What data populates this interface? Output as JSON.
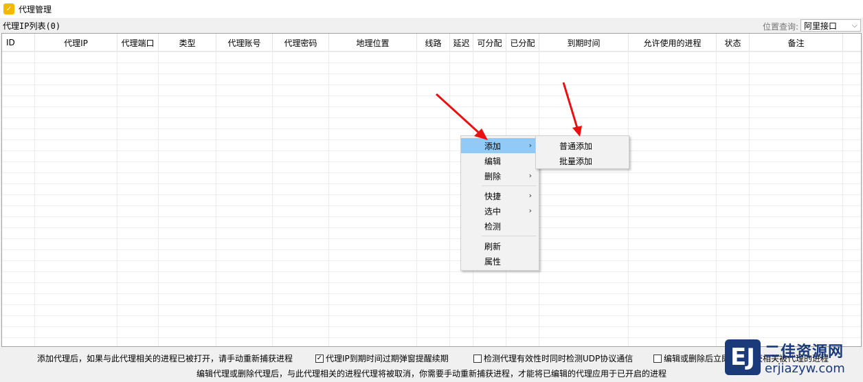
{
  "window": {
    "title": "代理管理",
    "icon": "app-logo-icon"
  },
  "listbar": {
    "list_label": "代理IP列表(0)",
    "location_label": "位置查询:",
    "location_value": "阿里接口"
  },
  "table": {
    "columns": [
      "ID",
      "代理IP",
      "代理端口",
      "类型",
      "代理账号",
      "代理密码",
      "地理位置",
      "线路",
      "延迟",
      "可分配",
      "已分配",
      "到期时间",
      "允许使用的进程",
      "状态",
      "备注"
    ],
    "rows": []
  },
  "context_menu": {
    "items": [
      {
        "label": "添加",
        "has_sub": true
      },
      {
        "label": "编辑",
        "has_sub": false
      },
      {
        "label": "删除",
        "has_sub": true
      },
      {
        "label": "快捷",
        "has_sub": true
      },
      {
        "label": "选中",
        "has_sub": true
      },
      {
        "label": "检测",
        "has_sub": false
      },
      {
        "label": "刷新",
        "has_sub": false
      },
      {
        "label": "属性",
        "has_sub": false
      }
    ],
    "submenu": [
      "普通添加",
      "批量添加"
    ]
  },
  "bottom": {
    "note1": "添加代理后，如果与此代理相关的进程已被打开，请手动重新捕获进程",
    "note2": "编辑代理或删除代理后，与此代理相关的进程代理将被取消，你需要手动重新捕获进程，才能将已编辑的代理应用于已开启的进程",
    "check1_label": "代理IP到期时间过期弹窗提醒续期",
    "check1_checked": true,
    "check2_label": "检测代理有效性时同时检测UDP协议通信",
    "check2_checked": false,
    "check3_label": "编辑或删除后立即重新捕获相关被代理的进程",
    "check3_checked": false
  },
  "watermark": {
    "logo": "EJ",
    "cn": "二佳资源网",
    "en": "erjiazyw.com"
  },
  "colors": {
    "menu_hover": "#91c9f7",
    "arrow_red": "#e81010",
    "watermark_blue": "#1a3a7a"
  }
}
